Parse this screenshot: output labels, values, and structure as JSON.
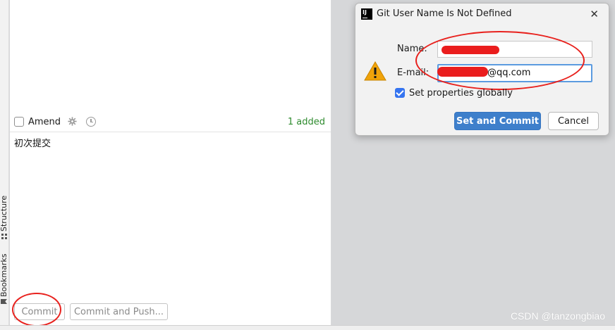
{
  "left_strip": {
    "structure_label": "Structure",
    "bookmarks_label": "Bookmarks"
  },
  "commit_panel": {
    "amend_label": "Amend",
    "amend_checked": false,
    "changes_status": "1 added",
    "commit_message": "初次提交",
    "commit_button": "Commit",
    "commit_push_button": "Commit and Push..."
  },
  "dialog": {
    "title": "Git User Name Is Not Defined",
    "close_glyph": "✕",
    "name_label": "Name:",
    "name_value": "",
    "email_label": "E-mail:",
    "email_value_visible": "@qq.com",
    "set_globally_label": "Set properties globally",
    "set_globally_checked": true,
    "set_commit_button": "Set and Commit",
    "cancel_button": "Cancel"
  },
  "watermark": "CSDN @tanzongbiao",
  "colors": {
    "primary_button": "#3e7fcb",
    "added_text": "#2e8b2e",
    "annotation_red": "#e8211d",
    "focus_border": "#5b9be0"
  },
  "icons": [
    "app-logo-icon",
    "close-icon",
    "warning-icon",
    "gear-icon",
    "clock-icon",
    "structure-icon",
    "bookmark-icon"
  ]
}
